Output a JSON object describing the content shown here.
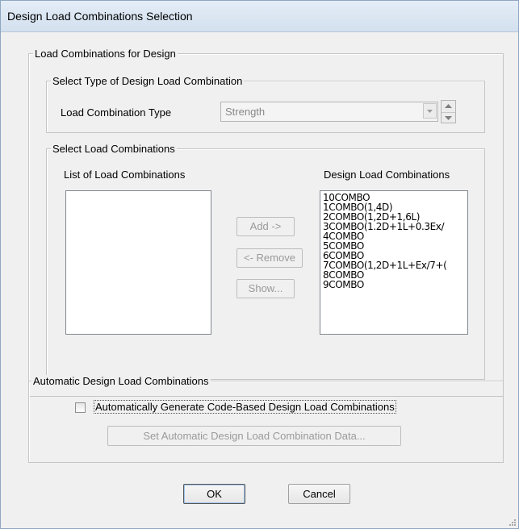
{
  "window": {
    "title": "Design Load Combinations Selection"
  },
  "groups": {
    "design": {
      "legend": "Load Combinations for Design"
    },
    "type": {
      "legend": "Select Type of Design Load Combination"
    },
    "select": {
      "legend": "Select Load Combinations"
    },
    "auto": {
      "legend": "Automatic Design Load Combinations"
    }
  },
  "type_selector": {
    "label": "Load Combination Type",
    "value": "Strength"
  },
  "lists": {
    "available_label": "List of Load Combinations",
    "available_items": [],
    "design_label": "Design Load Combinations",
    "design_items": [
      "10COMBO",
      "1COMBO(1,4D)",
      "2COMBO(1,2D+1,6L)",
      "3COMBO(1.2D+1L+0.3Ex/",
      "4COMBO",
      "5COMBO",
      "6COMBO",
      "7COMBO(1,2D+1L+Ex/7+(",
      "8COMBO",
      "9COMBO"
    ]
  },
  "buttons": {
    "add": "Add ->",
    "remove": "<- Remove",
    "show": "Show...",
    "set_auto": "Set Automatic Design Load Combination Data...",
    "ok": "OK",
    "cancel": "Cancel"
  },
  "auto": {
    "checkbox_label": "Automatically Generate Code-Based Design Load Combinations",
    "checked": false
  }
}
